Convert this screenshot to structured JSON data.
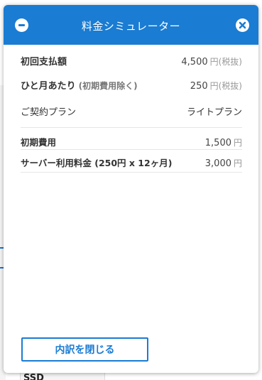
{
  "modal": {
    "title": "料金シミュレーター",
    "close_label": "内訳を閉じる"
  },
  "rows": [
    {
      "label": "初回支払額",
      "note": "",
      "value": "4,500",
      "unit": "円(税抜)"
    },
    {
      "label": "ひと月あたり",
      "note": "(初期費用除く)",
      "value": "250",
      "unit": "円(税抜)"
    },
    {
      "label": "ご契約プラン",
      "note": "",
      "value": "ライトプラン",
      "unit": ""
    },
    {
      "label": "初期費用",
      "note": "",
      "value": "1,500",
      "unit": "円"
    },
    {
      "label": "サーバー利用料金 (250円 x 12ヶ月)",
      "note": "",
      "value": "3,000",
      "unit": "円"
    }
  ],
  "background": {
    "ssd_label": "SSD"
  },
  "colors": {
    "accent": "#1a7cd2"
  }
}
